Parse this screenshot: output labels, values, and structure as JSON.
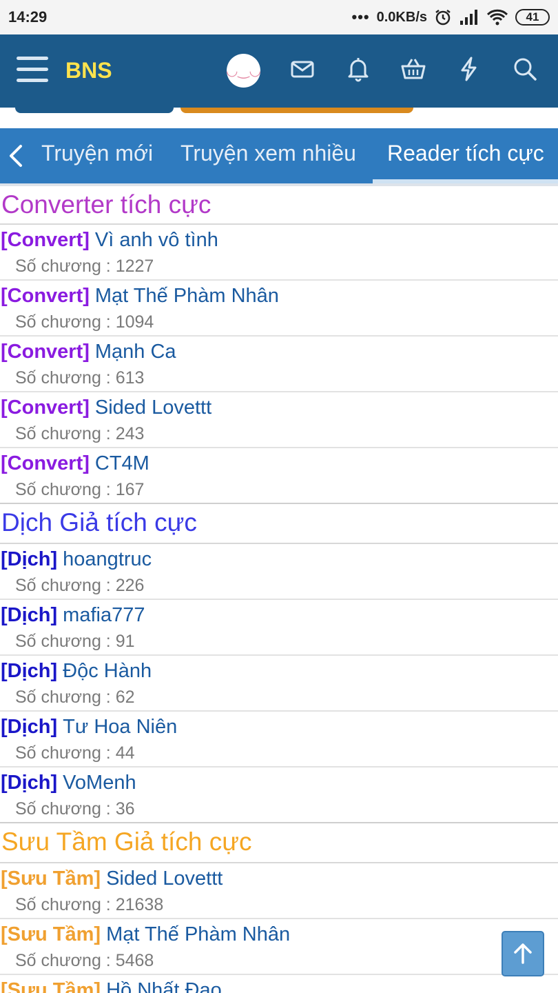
{
  "status": {
    "time": "14:29",
    "net": "0.0KB/s",
    "battery": "41",
    "dots": "•••"
  },
  "header": {
    "brand": "BNS"
  },
  "tabs": [
    {
      "label": "Truyện mới"
    },
    {
      "label": "Truyện xem nhiều"
    },
    {
      "label": "Reader tích cực"
    }
  ],
  "colors": {
    "converter": "#b239c8",
    "convert_tag": "#8a1be0",
    "translator": "#3a3ae6",
    "dich_tag": "#1a16c8",
    "collector": "#f5a623",
    "suu_tag": "#f0a030",
    "link": "#1a5aa0"
  },
  "sections": [
    {
      "title": "Converter tích cực",
      "items": [
        {
          "tag": "[Convert]",
          "name": "Vì anh vô tình",
          "meta": "Số chương : 1227"
        },
        {
          "tag": "[Convert]",
          "name": "Mạt Thế Phàm Nhân",
          "meta": "Số chương : 1094"
        },
        {
          "tag": "[Convert]",
          "name": "Mạnh Ca",
          "meta": "Số chương : 613"
        },
        {
          "tag": "[Convert]",
          "name": "Sided Lovettt",
          "meta": "Số chương : 243"
        },
        {
          "tag": "[Convert]",
          "name": "CT4M",
          "meta": "Số chương : 167"
        }
      ]
    },
    {
      "title": "Dịch Giả tích cực",
      "items": [
        {
          "tag": "[Dịch]",
          "name": "hoangtruc",
          "meta": "Số chương : 226"
        },
        {
          "tag": "[Dịch]",
          "name": "mafia777",
          "meta": "Số chương : 91"
        },
        {
          "tag": "[Dịch]",
          "name": "Độc Hành",
          "meta": "Số chương : 62"
        },
        {
          "tag": "[Dịch]",
          "name": "Tư Hoa Niên",
          "meta": "Số chương : 44"
        },
        {
          "tag": "[Dịch]",
          "name": "VoMenh",
          "meta": "Số chương : 36"
        }
      ]
    },
    {
      "title": "Sưu Tầm Giả tích cực",
      "items": [
        {
          "tag": "[Sưu Tầm]",
          "name": "Sided Lovettt",
          "meta": "Số chương : 21638"
        },
        {
          "tag": "[Sưu Tầm]",
          "name": "Mạt Thế Phàm Nhân",
          "meta": "Số chương : 5468"
        },
        {
          "tag": "[Sưu Tầm]",
          "name": "Hồ Nhất Đao",
          "meta": ""
        }
      ]
    }
  ]
}
